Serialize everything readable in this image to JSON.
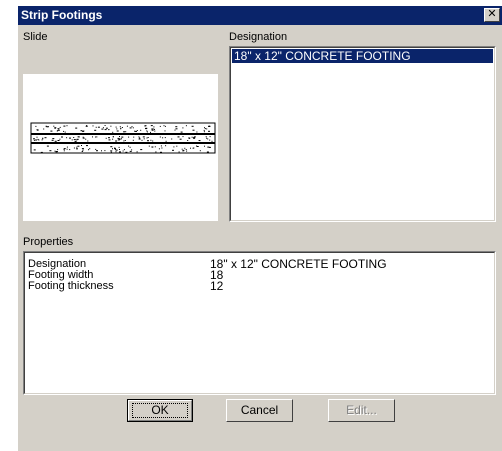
{
  "window": {
    "title": "Strip Footings",
    "close_glyph": "✕"
  },
  "slide": {
    "label": "Slide"
  },
  "designation": {
    "label": "Designation",
    "items": [
      "18\" x 12\" CONCRETE FOOTING"
    ],
    "selected_index": 0
  },
  "properties": {
    "label": "Properties",
    "rows": [
      {
        "name": "Designation",
        "value": "18\" x 12\" CONCRETE FOOTING"
      },
      {
        "name": "Footing width",
        "value": "18"
      },
      {
        "name": "Footing thickness",
        "value": "12"
      }
    ]
  },
  "buttons": {
    "ok": "OK",
    "cancel": "Cancel",
    "edit": "Edit..."
  },
  "colors": {
    "titlebar": "#0a246a",
    "face": "#d4d0c8",
    "selection": "#0a246a"
  }
}
